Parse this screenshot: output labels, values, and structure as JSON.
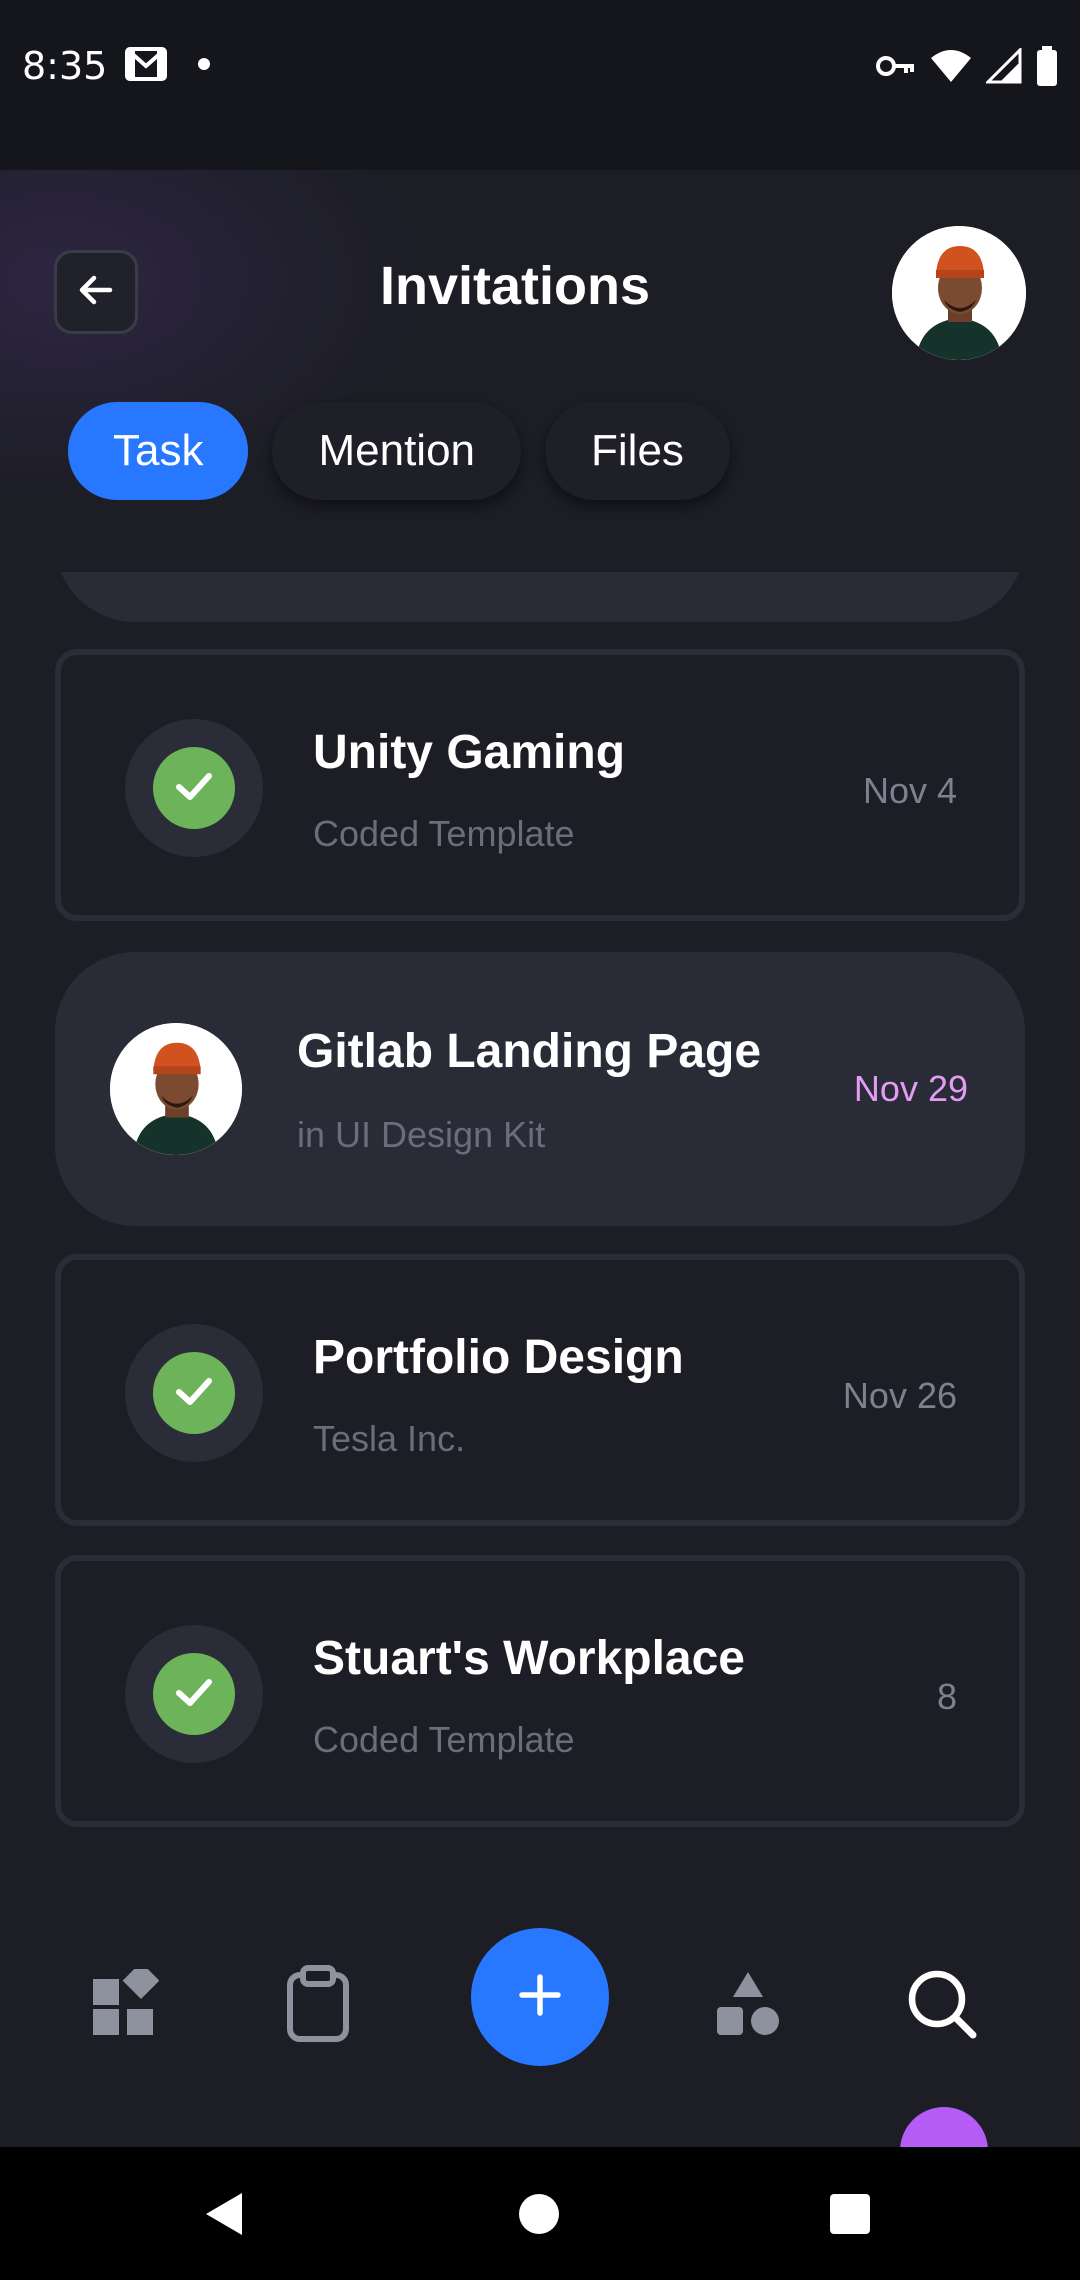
{
  "status_bar": {
    "time": "8:35",
    "left_icons": [
      "gmail-icon",
      "dot-icon"
    ],
    "right_icons": [
      "vpn-key-icon",
      "wifi-icon",
      "signal-icon",
      "battery-icon"
    ]
  },
  "header": {
    "title": "Invitations",
    "back_icon": "arrow-left-icon"
  },
  "tabs": [
    {
      "label": "Task",
      "active": true
    },
    {
      "label": "Mention",
      "active": false
    },
    {
      "label": "Files",
      "active": false
    }
  ],
  "items": [
    {
      "title": "Unity Gaming",
      "subtitle": "Coded Template",
      "meta": "Nov 4",
      "icon": "check-icon"
    },
    {
      "title": "Gitlab Landing Page",
      "subtitle": "in UI Design Kit",
      "meta": "Nov 29",
      "icon": "avatar"
    },
    {
      "title": "Portfolio Design",
      "subtitle": "Tesla Inc.",
      "meta": "Nov 26",
      "icon": "check-icon"
    },
    {
      "title": "Stuart's Workplace",
      "subtitle": "Coded Template",
      "meta": "8",
      "icon": "check-icon"
    }
  ],
  "bottom_nav": [
    "dashboard-icon",
    "clipboard-icon",
    "plus-icon",
    "shapes-icon",
    "search-icon"
  ],
  "system_nav": [
    "back-triangle-icon",
    "home-circle-icon",
    "recents-square-icon"
  ],
  "colors": {
    "background": "#1c1d25",
    "card": "#292c37",
    "accent_blue": "#2877ff",
    "check_green": "#6db35a",
    "highlight_date": "#e59bf2",
    "active_indicator": "#b45cf5"
  }
}
